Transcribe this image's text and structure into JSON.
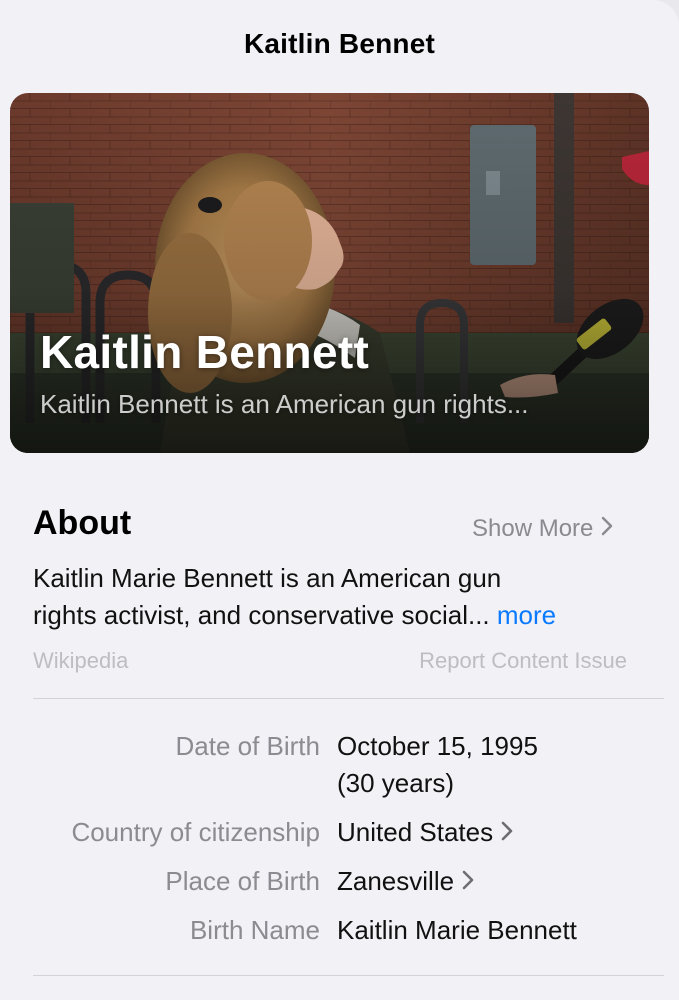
{
  "header": {
    "title": "Kaitlin Bennet"
  },
  "hero": {
    "title": "Kaitlin Bennett",
    "subtitle": "Kaitlin Bennett is an American gun rights..."
  },
  "about": {
    "heading": "About",
    "show_more_label": "Show More",
    "text": "Kaitlin Marie Bennett is an American gun rights activist, and conservative social...",
    "text_line1": "Kaitlin Marie Bennett is an American gun",
    "text_line2": "rights activist, and conservative social...",
    "more_link": "more",
    "source": "Wikipedia",
    "report_label": "Report Content Issue"
  },
  "facts": [
    {
      "label": "Date of Birth",
      "value": "October 15, 1995",
      "value_line2": "(30 years)",
      "has_chevron": false
    },
    {
      "label": "Country of citizenship",
      "value": "United States",
      "has_chevron": true
    },
    {
      "label": "Place of Birth",
      "value": "Zanesville",
      "has_chevron": true
    },
    {
      "label": "Birth Name",
      "value": "Kaitlin Marie Bennett",
      "has_chevron": false
    }
  ],
  "colors": {
    "background": "#f2f1f6",
    "link_blue": "#0a7aff",
    "secondary_gray": "#8b8b90",
    "tertiary_gray": "#bdbdc2"
  },
  "icons": [
    "chevron-right-icon"
  ]
}
